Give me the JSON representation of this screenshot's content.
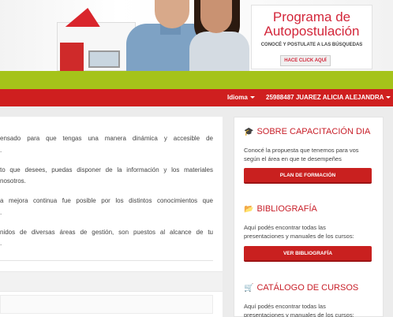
{
  "banner": {
    "promo_title_1": "Programa de",
    "promo_title_2": "Autopostulación",
    "promo_subtitle": "CONOCÉ Y POSTULATE A LAS BÚSQUEDAS",
    "promo_button": "HACE CLICK AQUÍ"
  },
  "nav": {
    "language_label": "Idioma",
    "user_label": "25988487 JUAREZ ALICIA ALEJANDRA"
  },
  "main": {
    "paragraphs": [
      [
        "ensado para que tengas una manera dinámica y accesible de",
        "."
      ],
      [
        "to que desees, puedas disponer de la información y los materiales",
        "nosotros."
      ],
      [
        "a mejora continua fue posible por los distintos conocimientos que",
        "."
      ],
      [
        "nidos de diversas áreas de gestión, son puestos al alcance de tu",
        "."
      ]
    ]
  },
  "sidebar": {
    "capacitacion": {
      "title": "SOBRE CAPACITACIÓN DIA",
      "icon": "graduation-cap-icon",
      "text_1": "Conocé la propuesta que tenemos para vos",
      "text_2": "según el área en que te desempeñes",
      "button": "PLAN DE FORMACIÓN"
    },
    "bibliografia": {
      "title": "BIBLIOGRAFÍA",
      "icon": "folder-icon",
      "text_1": "Aquí podés encontrar todas las",
      "text_2": "presentaciones y manuales de los cursos:",
      "button": "VER BIBLIOGRAFÍA"
    },
    "catalogo": {
      "title": "CATÁLOGO DE CURSOS",
      "icon": "cart-icon",
      "text_1": "Aquí podés encontrar todas las",
      "text_2": "presentaciones y manuales de los cursos:"
    }
  },
  "colors": {
    "accent_red": "#cf1f1f",
    "accent_green": "#a5c31a",
    "heading_red": "#c8202a"
  }
}
